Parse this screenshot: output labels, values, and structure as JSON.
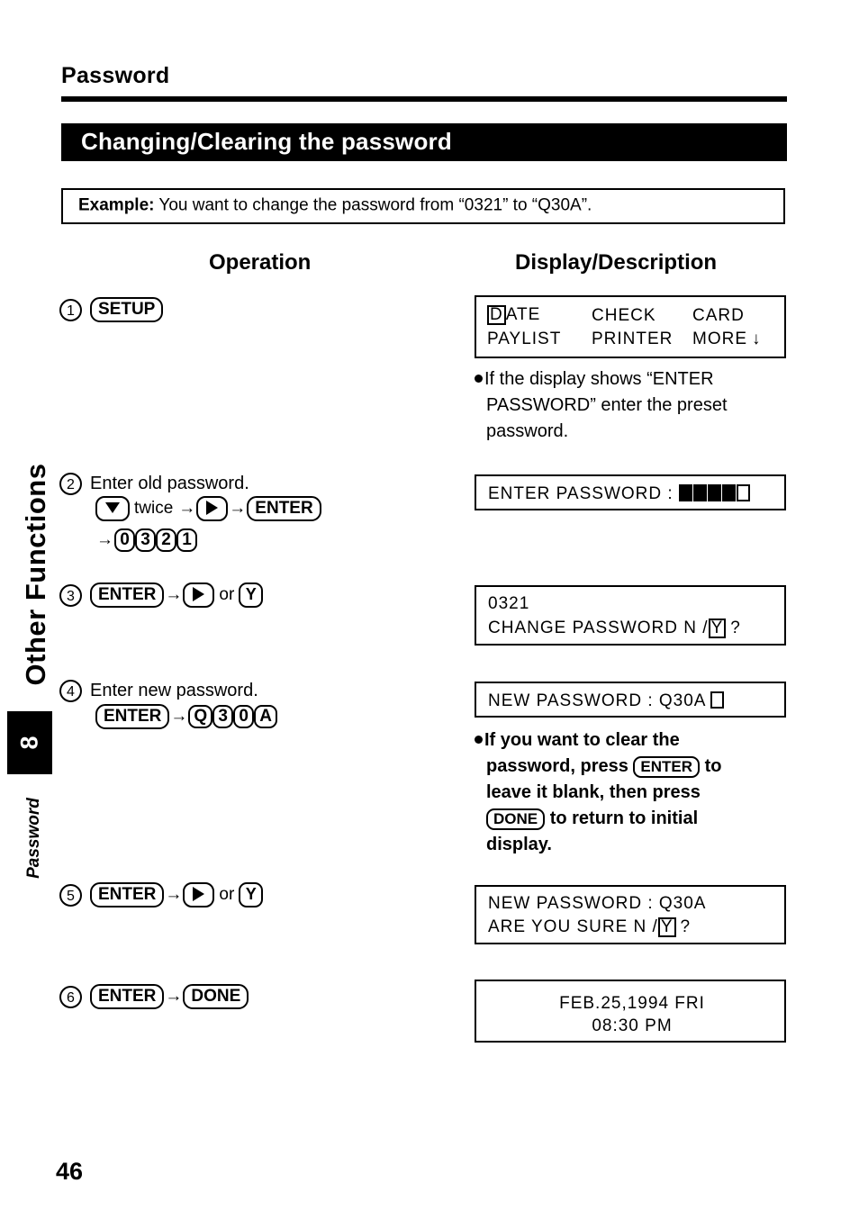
{
  "page": {
    "title": "Password",
    "section_heading": "Changing/Clearing the password",
    "page_number": "46"
  },
  "sidebar": {
    "chapter_label": "Other Functions",
    "chapter_number": "8",
    "section_label": "Password"
  },
  "example": {
    "label": "Example:",
    "text": "You want to change the password from “0321” to “Q30A”."
  },
  "columns": {
    "operation": "Operation",
    "display": "Display/Description"
  },
  "steps": [
    {
      "number": "1",
      "instruction": "",
      "keys": [
        "SETUP"
      ]
    },
    {
      "number": "2",
      "instruction": "Enter old password.",
      "keys": [
        "down-arrow",
        "twice",
        "right-arrow",
        "ENTER",
        "0",
        "3",
        "2",
        "1"
      ]
    },
    {
      "number": "3",
      "instruction": "",
      "keys": [
        "ENTER",
        "right-arrow",
        "or",
        "Y"
      ]
    },
    {
      "number": "4",
      "instruction": "Enter new password.",
      "keys": [
        "ENTER",
        "Q",
        "3",
        "0",
        "A"
      ]
    },
    {
      "number": "5",
      "instruction": "",
      "keys": [
        "ENTER",
        "right-arrow",
        "or",
        "Y"
      ]
    },
    {
      "number": "6",
      "instruction": "",
      "keys": [
        "ENTER",
        "DONE"
      ]
    }
  ],
  "step_labels": {
    "s1_num": "1",
    "s2_num": "2",
    "s3_num": "3",
    "s4_num": "4",
    "s5_num": "5",
    "s6_num": "6",
    "s2_text": "Enter old password.",
    "s4_text": "Enter new password.",
    "twice": "twice",
    "or": "or"
  },
  "keys": {
    "setup": "SETUP",
    "enter": "ENTER",
    "done": "DONE",
    "y": "Y",
    "q": "Q",
    "a": "A",
    "d0": "0",
    "d3": "3",
    "d2": "2",
    "d1": "1"
  },
  "displays": {
    "menu": {
      "cursor_char": "D",
      "line1_rest": "ATE",
      "line1_col2": "CHECK",
      "line1_col3": "CARD",
      "line2_col1": "PAYLIST",
      "line2_col2": "PRINTER",
      "line2_col3": "MORE",
      "more_arrow": "↓"
    },
    "enter_password": {
      "label": "ENTER PASSWORD :",
      "filled_blocks": 4,
      "cursor_block": 1
    },
    "change_password": {
      "line1": "0321",
      "line2_pre": "CHANGE PASSWORD N /",
      "cursor_char": "Y",
      "line2_post": "?"
    },
    "new_password": {
      "label": "NEW PASSWORD : Q30A",
      "cursor_block": 1
    },
    "are_you_sure": {
      "line1": "NEW PASSWORD : Q30A",
      "line2_pre": "ARE YOU SURE N /",
      "cursor_char": "Y",
      "line2_post": "?"
    },
    "initial": {
      "line1": "FEB.25,1994 FRI",
      "line2": "08:30 PM"
    }
  },
  "notes": {
    "note1_line1": "If the display shows “ENTER",
    "note1_line2": "PASSWORD” enter the preset",
    "note1_line3": "password.",
    "note2_line1": "If you want to clear the",
    "note2_line2a": "password, press",
    "note2_line2b": "to",
    "note2_line3": "leave it blank, then press",
    "note2_line4b": "to return to initial",
    "note2_line5": "display."
  }
}
